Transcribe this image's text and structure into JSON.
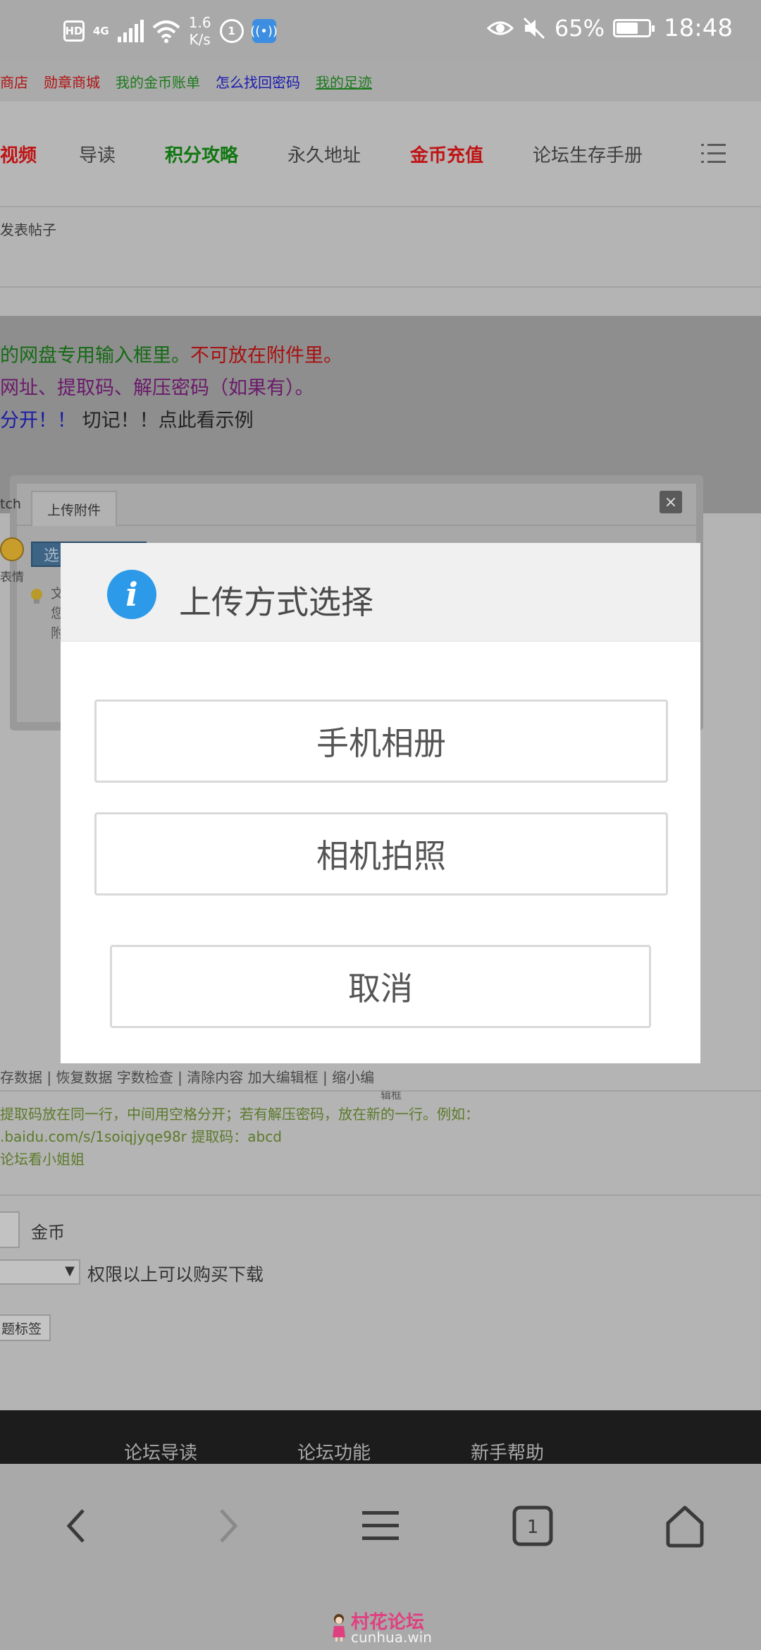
{
  "status_bar": {
    "hd": "HD",
    "network": "4G",
    "speed_value": "1.6",
    "speed_unit": "K/s",
    "sim_badge": "1",
    "battery": "65%",
    "battery_level": 0.65,
    "time": "18:48"
  },
  "top_links": [
    {
      "label": "商店",
      "color": "#b01212"
    },
    {
      "label": "勋章商城",
      "color": "#b01212"
    },
    {
      "label": "我的金币账单",
      "color": "#1d7a1d"
    },
    {
      "label": "怎么找回密码",
      "color": "#1a1ab0"
    },
    {
      "label": "我的足迹",
      "color": "#1d7a1d"
    }
  ],
  "nav": {
    "items": [
      {
        "label": "视频",
        "color": "#c01414",
        "bold": true
      },
      {
        "label": "导读",
        "color": "#3f3f3f",
        "bold": false
      },
      {
        "label": "积分攻略",
        "color": "#117711",
        "bold": true
      },
      {
        "label": "永久地址",
        "color": "#3f3f3f",
        "bold": false
      },
      {
        "label": "金币充值",
        "color": "#c01414",
        "bold": true
      },
      {
        "label": "论坛生存手册",
        "color": "#3f3f3f",
        "bold": false
      }
    ],
    "menu_icon": "list-menu-icon"
  },
  "breadcrumb": "发表帖子",
  "notice": {
    "line1_green": "的网盘专用输入框里。",
    "line1_red": "不可放在附件里。",
    "line2": "网址、提取码、解压密码（如果有）。",
    "line3_blue": "分开！！",
    "line3_dark": "切记！！点此看示例"
  },
  "upload_dialog": {
    "tab": "上传附件",
    "close": "×",
    "select_button": "选",
    "left_fragment": "tch",
    "side_text": [
      "文",
      "您",
      "附"
    ]
  },
  "emoji_label": "表情",
  "editor_links": "存数据 | 恢复数据    字数检查 | 清除内容    加大编辑框 | 缩小编",
  "editor_caption": "辑框",
  "hints": [
    "提取码放在同一行，中间用空格分开；若有解压密码，放在新的一行。例如：",
    ".baidu.com/s/1soiqjyqe98r 提取码：abcd",
    "论坛看小姐姐"
  ],
  "price_unit": "金币",
  "permission_text": "权限以上可以购买下载",
  "select_arrow": "▼",
  "tag_button": "题标签",
  "footer_links": [
    "论坛导读",
    "论坛功能",
    "新手帮助"
  ],
  "modal": {
    "title": "上传方式选择",
    "icon": "info-icon",
    "info_glyph": "i",
    "options": [
      "手机相册",
      "相机拍照"
    ],
    "cancel": "取消"
  },
  "browser_bar": {
    "icons": [
      "back-icon",
      "forward-icon",
      "menu-icon",
      "tabs-icon",
      "home-icon"
    ],
    "tab_count": "1"
  },
  "watermark": {
    "title": "村花论坛",
    "url": "cunhua.win"
  }
}
